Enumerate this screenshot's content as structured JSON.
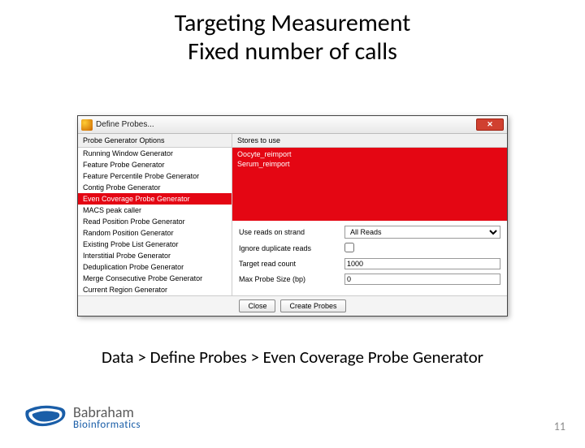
{
  "slide": {
    "title_line1": "Targeting Measurement",
    "title_line2": "Fixed number of calls",
    "caption": "Data > Define Probes > Even Coverage Probe Generator",
    "page_number": "11",
    "logo_top": "Babraham",
    "logo_bottom": "Bioinformatics"
  },
  "dialog": {
    "title": "Define Probes...",
    "subheader_left": "Probe Generator Options",
    "subheader_right": "Stores to use",
    "close_label": "✕",
    "generators": [
      "Running Window Generator",
      "Feature Probe Generator",
      "Feature Percentile Probe Generator",
      "Contig Probe Generator",
      "Even Coverage Probe Generator",
      "MACS peak caller",
      "Read Position Probe Generator",
      "Random Position Generator",
      "Existing Probe List Generator",
      "Interstitial Probe Generator",
      "Deduplication Probe Generator",
      "Merge Consecutive Probe Generator",
      "Current Region Generator"
    ],
    "selected_generator_index": 4,
    "stores": [
      "Oocyte_reimport",
      "Serum_reimport"
    ],
    "options": {
      "strand_label": "Use reads on strand",
      "strand_value": "All Reads",
      "ignore_dup_label": "Ignore duplicate reads",
      "ignore_dup_checked": false,
      "target_count_label": "Target read count",
      "target_count_value": "1000",
      "max_probe_label": "Max Probe Size (bp)",
      "max_probe_value": "0"
    },
    "buttons": {
      "close": "Close",
      "create": "Create Probes"
    }
  }
}
